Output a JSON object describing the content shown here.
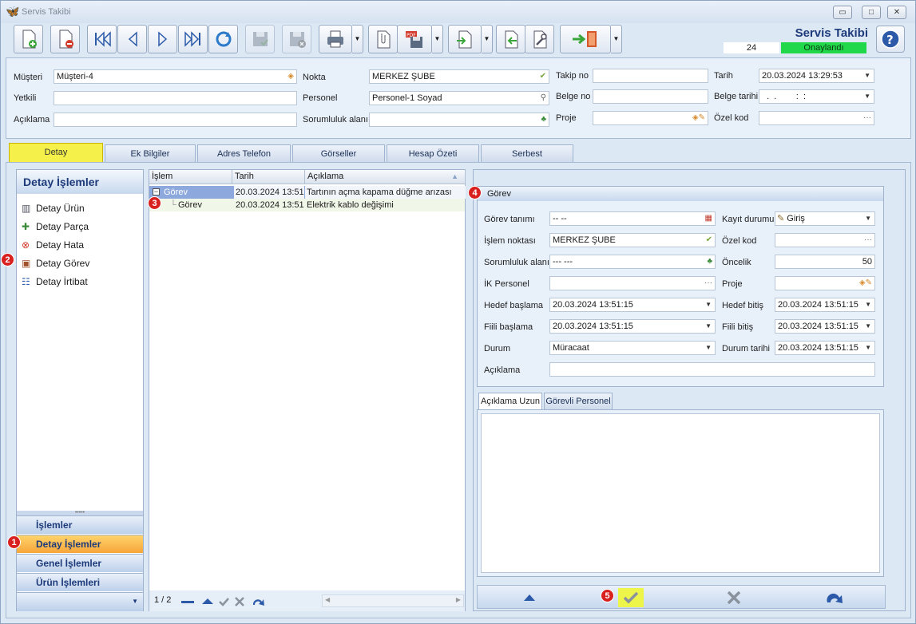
{
  "window": {
    "title": "Servis Takibi",
    "minimize": "▭",
    "maximize": "□",
    "close": "✕"
  },
  "brand": {
    "title": "Servis Takibi",
    "count": "24",
    "status": "Onaylandı",
    "status_color": "#21d84a"
  },
  "header": {
    "musteri_label": "Müşteri",
    "musteri_value": "Müşteri-4",
    "yetkili_label": "Yetkili",
    "yetkili_value": "",
    "aciklama_label": "Açıklama",
    "aciklama_value": "",
    "nokta_label": "Nokta",
    "nokta_value": "MERKEZ ŞUBE",
    "personel_label": "Personel",
    "personel_value": "Personel-1 Soyad",
    "sorumluluk_label": "Sorumluluk alanı",
    "sorumluluk_value": "",
    "takip_label": "Takip no",
    "takip_value": "",
    "belge_label": "Belge no",
    "belge_value": "",
    "proje_label": "Proje",
    "proje_value": "",
    "tarih_label": "Tarih",
    "tarih_value": "20.03.2024 13:29:53",
    "belge_tarihi_label": "Belge tarihi",
    "belge_tarihi_value": "  .  .        :  :",
    "ozel_kod_label": "Özel kod",
    "ozel_kod_value": "···"
  },
  "tabs": [
    "Detay",
    "Ek Bilgiler",
    "Adres Telefon",
    "Görseller",
    "Hesap Özeti",
    "Serbest"
  ],
  "left_panel": {
    "title": "Detay İşlemler",
    "items": [
      "Detay Ürün",
      "Detay Parça",
      "Detay Hata",
      "Detay Görev",
      "Detay İrtibat"
    ],
    "nav": [
      "İşlemler",
      "Detay İşlemler",
      "Genel İşlemler",
      "Ürün İşlemleri"
    ]
  },
  "markers": [
    "1",
    "2",
    "3",
    "4",
    "5"
  ],
  "grid": {
    "columns": [
      "İşlem",
      "Tarih",
      "Açıklama"
    ],
    "rows": [
      {
        "islem": "Görev",
        "tarih": "20.03.2024 13:51:",
        "aciklama": "Tartının açma kapama düğme arızası"
      },
      {
        "islem": "Görev",
        "tarih": "20.03.2024 13:51:",
        "aciklama": "Elektrik kablo değişimi"
      }
    ],
    "pager": "1 / 2",
    "expander": "−"
  },
  "gorev": {
    "title": "Görev",
    "gorev_tanimi_label": "Görev tanımı",
    "gorev_tanimi_value": "-- --",
    "islem_noktasi_label": "İşlem noktası",
    "islem_noktasi_value": "MERKEZ ŞUBE",
    "sorumluluk_label": "Sorumluluk alanı",
    "sorumluluk_value": "--- ---",
    "ik_personel_label": "İK Personel",
    "ik_personel_value": "···",
    "hedef_baslama_label": "Hedef başlama",
    "hedef_baslama_value": "20.03.2024 13:51:15",
    "fiili_baslama_label": "Fiili başlama",
    "fiili_baslama_value": "20.03.2024 13:51:15",
    "durum_label": "Durum",
    "durum_value": "Müracaat",
    "aciklama_label": "Açıklama",
    "aciklama_value": "",
    "kayit_durumu_label": "Kayıt durumu",
    "kayit_durumu_value": "Giriş",
    "ozel_kod_label": "Özel kod",
    "ozel_kod_value": "···",
    "oncelik_label": "Öncelik",
    "oncelik_value": "50",
    "proje_label": "Proje",
    "proje_value": "",
    "hedef_bitis_label": "Hedef bitiş",
    "hedef_bitis_value": "20.03.2024 13:51:15",
    "fiili_bitis_label": "Fiili bitiş",
    "fiili_bitis_value": "20.03.2024 13:51:15",
    "durum_tarihi_label": "Durum tarihi",
    "durum_tarihi_value": "20.03.2024 13:51:15"
  },
  "inner_tabs": [
    "Açıklama Uzun",
    "Görevli Personel"
  ],
  "colors": {
    "accent_yellow": "#f6f14a",
    "active_nav": "#f6a53a",
    "marker_red": "#d8201f",
    "selected_row": "#8ca8dc"
  }
}
